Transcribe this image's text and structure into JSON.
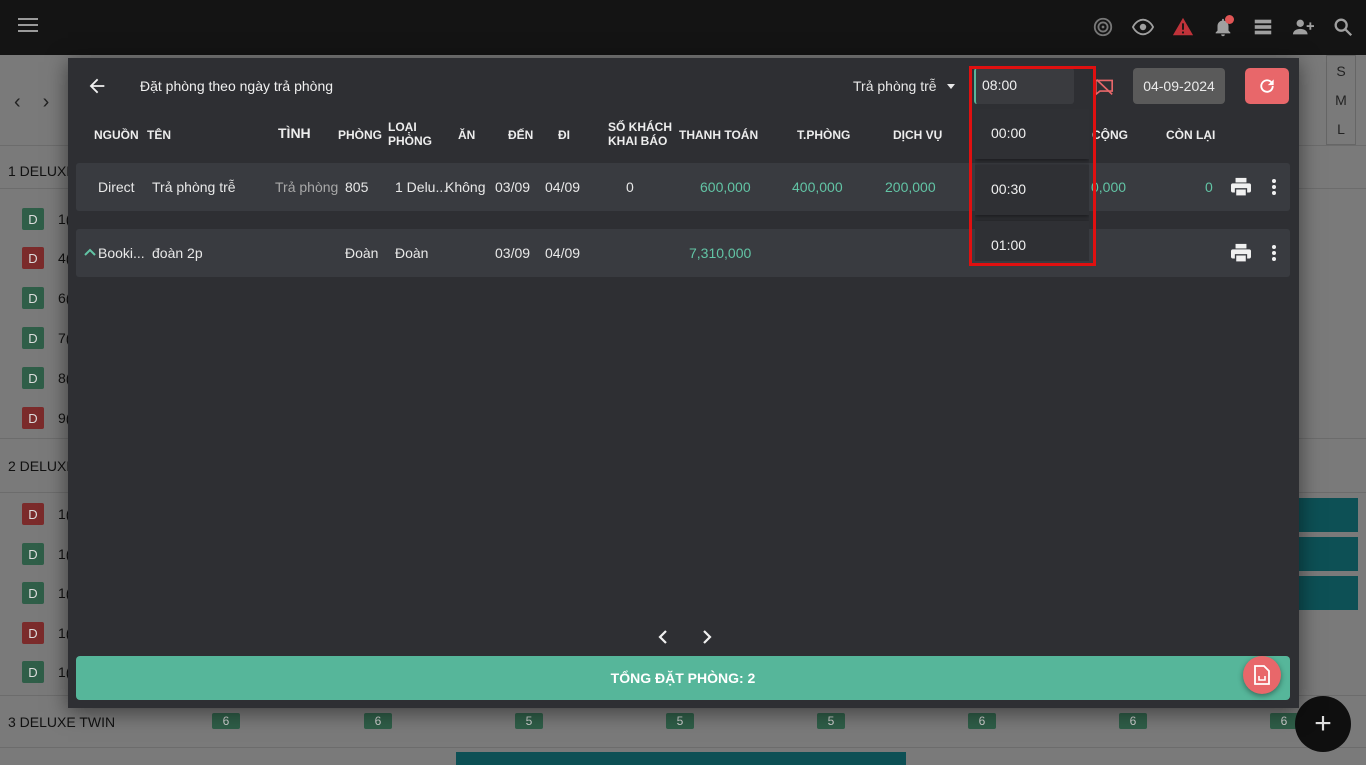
{
  "colors": {
    "accent": "#56b69a",
    "danger": "#e8676a",
    "highlight": "#e01010"
  },
  "background": {
    "groups": [
      "1 DELUXE",
      "2 DELUXE",
      "3 DELUXE TWIN"
    ],
    "rooms_group1": [
      {
        "badge": "D",
        "color": "green",
        "no": "1("
      },
      {
        "badge": "D",
        "color": "red",
        "no": "4("
      },
      {
        "badge": "D",
        "color": "green",
        "no": "6("
      },
      {
        "badge": "D",
        "color": "green",
        "no": "7("
      },
      {
        "badge": "D",
        "color": "green",
        "no": "8("
      },
      {
        "badge": "D",
        "color": "red",
        "no": "9("
      }
    ],
    "rooms_group2": [
      {
        "badge": "D",
        "color": "red",
        "no": "1("
      },
      {
        "badge": "D",
        "color": "green",
        "no": "1("
      },
      {
        "badge": "D",
        "color": "green",
        "no": "1("
      },
      {
        "badge": "D",
        "color": "red",
        "no": "1("
      },
      {
        "badge": "D",
        "color": "green",
        "no": "1("
      }
    ],
    "counts": [
      "6",
      "6",
      "5",
      "5",
      "5",
      "6",
      "6",
      "6"
    ],
    "size_options": [
      "S",
      "M",
      "L"
    ],
    "fab_label": "+"
  },
  "topbar_icons": [
    "radar-icon",
    "eye-icon",
    "warning-icon",
    "bell-icon",
    "list-icon",
    "add-user-icon",
    "search-icon"
  ],
  "dialog": {
    "title": "Đặt phòng theo ngày trả phòng",
    "filter_label": "Trả phòng trễ",
    "time_value": "08:00",
    "date_value": "04-09-2024",
    "columns": {
      "nguon": "NGUỒN",
      "ten": "TÊN",
      "tinh": "TÌNH",
      "phong": "PHÒNG",
      "loai1": "LOẠI",
      "loai2": "PHÒNG",
      "an": "ĂN",
      "den": "ĐẾN",
      "di": "ĐI",
      "sokhach1": "SỐ KHÁCH",
      "sokhach2": "KHAI BÁO",
      "thanhtoan": "THANH TOÁN",
      "tphong": "T.PHÒNG",
      "dichvu": "DỊCH VỤ",
      "cong": "CỘNG",
      "conlai": "CÒN LẠI"
    },
    "rows": [
      {
        "nguon": "Direct",
        "ten": "Trả phòng trễ",
        "tinh": "Trả phòng",
        "phong": "805",
        "loai": "1 Delu...",
        "an": "Không",
        "den": "03/09",
        "di": "04/09",
        "sokhach": "0",
        "thanhtoan": "600,000",
        "tphong": "400,000",
        "dichvu": "200,000",
        "cong": "0,000",
        "conlai": "0"
      },
      {
        "nguon": "Booki...",
        "ten": "đoàn 2p",
        "tinh": "",
        "phong": "Đoàn",
        "loai": "Đoàn",
        "an": "",
        "den": "03/09",
        "di": "04/09",
        "sokhach": "",
        "thanhtoan": "7,310,000",
        "tphong": "",
        "dichvu": "",
        "cong": "",
        "conlai": ""
      }
    ],
    "total_label": "TỔNG ĐẶT PHÒNG: 2",
    "time_options": [
      "00:00",
      "00:30",
      "01:00"
    ]
  }
}
